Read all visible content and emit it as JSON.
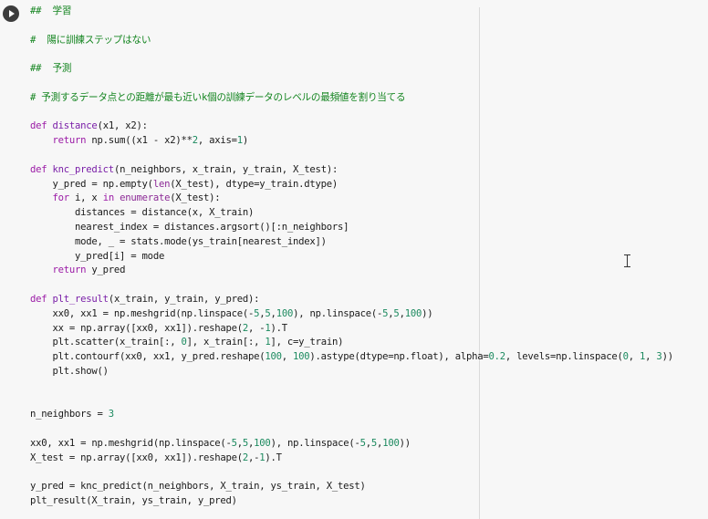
{
  "cell": {
    "run_button_icon": "play-icon",
    "lines": [
      "##  学習",
      "",
      "#  陽に訓練ステップはない",
      "",
      "##  予測",
      "",
      "# 予測するデータ点との距離が最も近いk個の訓練データのレベルの最頻値を割り当てる",
      "",
      "def distance(x1, x2):",
      "    return np.sum((x1 - x2)**2, axis=1)",
      "",
      "def knc_predict(n_neighbors, x_train, y_train, X_test):",
      "    y_pred = np.empty(len(X_test), dtype=y_train.dtype)",
      "    for i, x in enumerate(X_test):",
      "        distances = distance(x, X_train)",
      "        nearest_index = distances.argsort()[:n_neighbors]",
      "        mode, _ = stats.mode(ys_train[nearest_index])",
      "        y_pred[i] = mode",
      "    return y_pred",
      "",
      "def plt_result(x_train, y_train, y_pred):",
      "    xx0, xx1 = np.meshgrid(np.linspace(-5,5,100), np.linspace(-5,5,100))",
      "    xx = np.array([xx0, xx1]).reshape(2, -1).T",
      "    plt.scatter(x_train[:, 0], x_train[:, 1], c=y_train)",
      "    plt.contourf(xx0, xx1, y_pred.reshape(100, 100).astype(dtype=np.float), alpha=0.2, levels=np.linspace(0, 1, 3))",
      "    plt.show()",
      "",
      "",
      "n_neighbors = 3",
      "",
      "xx0, xx1 = np.meshgrid(np.linspace(-5,5,100), np.linspace(-5,5,100))",
      "X_test = np.array([xx0, xx1]).reshape(2,-1).T",
      "",
      "y_pred = knc_predict(n_neighbors, X_train, ys_train, X_test)",
      "plt_result(X_train, ys_train, y_pred)"
    ]
  },
  "colors": {
    "background": "#f7f7f7",
    "keyword": "#9b1ba6",
    "function_name": "#7a1fa8",
    "number": "#1c8a5f",
    "comment": "#148520",
    "text": "#1a1a1a"
  }
}
